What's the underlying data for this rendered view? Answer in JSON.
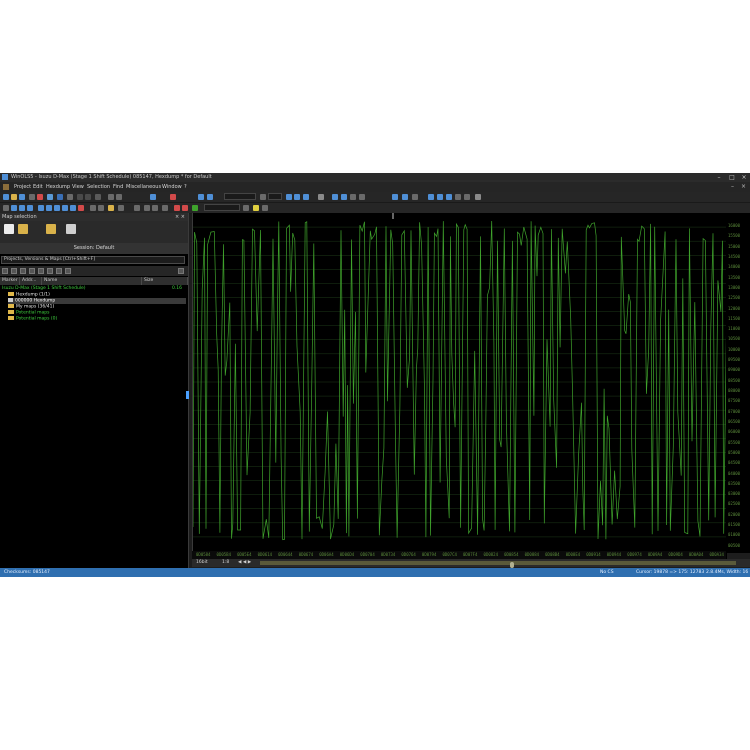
{
  "window": {
    "title": "WinOLS5 - Isuzu D-Max (Stage 1 Shift Schedule) 085147, Hexdump * for Default",
    "minimize": "–",
    "maximize": "□",
    "close": "×"
  },
  "menu": {
    "items": [
      "Project",
      "Edit",
      "Hexdump",
      "View",
      "Selection",
      "Find",
      "Miscellaneous",
      "Window",
      "?"
    ],
    "right": [
      "–",
      "×"
    ]
  },
  "map_panel": {
    "title": "Map selection",
    "close": "× ×",
    "session": "Session: Default",
    "filter_placeholder": "Projects, Versions & Maps  [Ctrl+Shift+F]",
    "columns": [
      "Marker",
      "Addr...",
      "Name",
      "Size"
    ],
    "tree": [
      {
        "label": "Isuzu D-Max (Stage 1 Shift Schedule)",
        "right": "0.16",
        "kind": "project"
      },
      {
        "label": "Hexdump (1/1)",
        "kind": "folder"
      },
      {
        "label": "000000  Hexdump",
        "kind": "item"
      },
      {
        "label": "My maps (36/41)",
        "kind": "folder"
      },
      {
        "label": "Potential maps",
        "kind": "folder"
      },
      {
        "label": "Potential maps (0)",
        "kind": "folder"
      }
    ]
  },
  "graph": {
    "y_labels": [
      "16000",
      "15500",
      "15000",
      "14500",
      "14000",
      "13500",
      "13000",
      "12500",
      "12000",
      "11500",
      "11000",
      "10500",
      "10000",
      "09500",
      "09000",
      "08500",
      "08000",
      "07500",
      "07000",
      "06500",
      "06000",
      "05500",
      "05000",
      "04500",
      "04000",
      "03500",
      "03000",
      "02500",
      "02000",
      "01500",
      "01000",
      "00500"
    ],
    "x_labels": [
      "0D0584",
      "0D05B4",
      "0D05E4",
      "0D0614",
      "0D0644",
      "0D0674",
      "0D06A4",
      "0D06D4",
      "0D0704",
      "0D0734",
      "0D0764",
      "0D0794",
      "0D07C4",
      "0D07F4",
      "0D0824",
      "0D0854",
      "0D0884",
      "0D08B4",
      "0D08E4",
      "0D0914",
      "0D0944",
      "0D0974",
      "0D09A4",
      "0D09D4",
      "0D0A04",
      "0D0A34"
    ]
  },
  "navbar": {
    "mode": "16bit",
    "zoom": "1:8",
    "arrows": "◀ ◀ ▶"
  },
  "status": {
    "left": "Checksums: 085147",
    "no_cs": "No CS",
    "cursor": "Cursor: 19878 => 175: 12783",
    "right": "2.8.4Ms, Width: 16"
  },
  "colors": {
    "wave": "#3fa32c",
    "grid": "#1e3a18",
    "accent": "#2f6fb0"
  }
}
